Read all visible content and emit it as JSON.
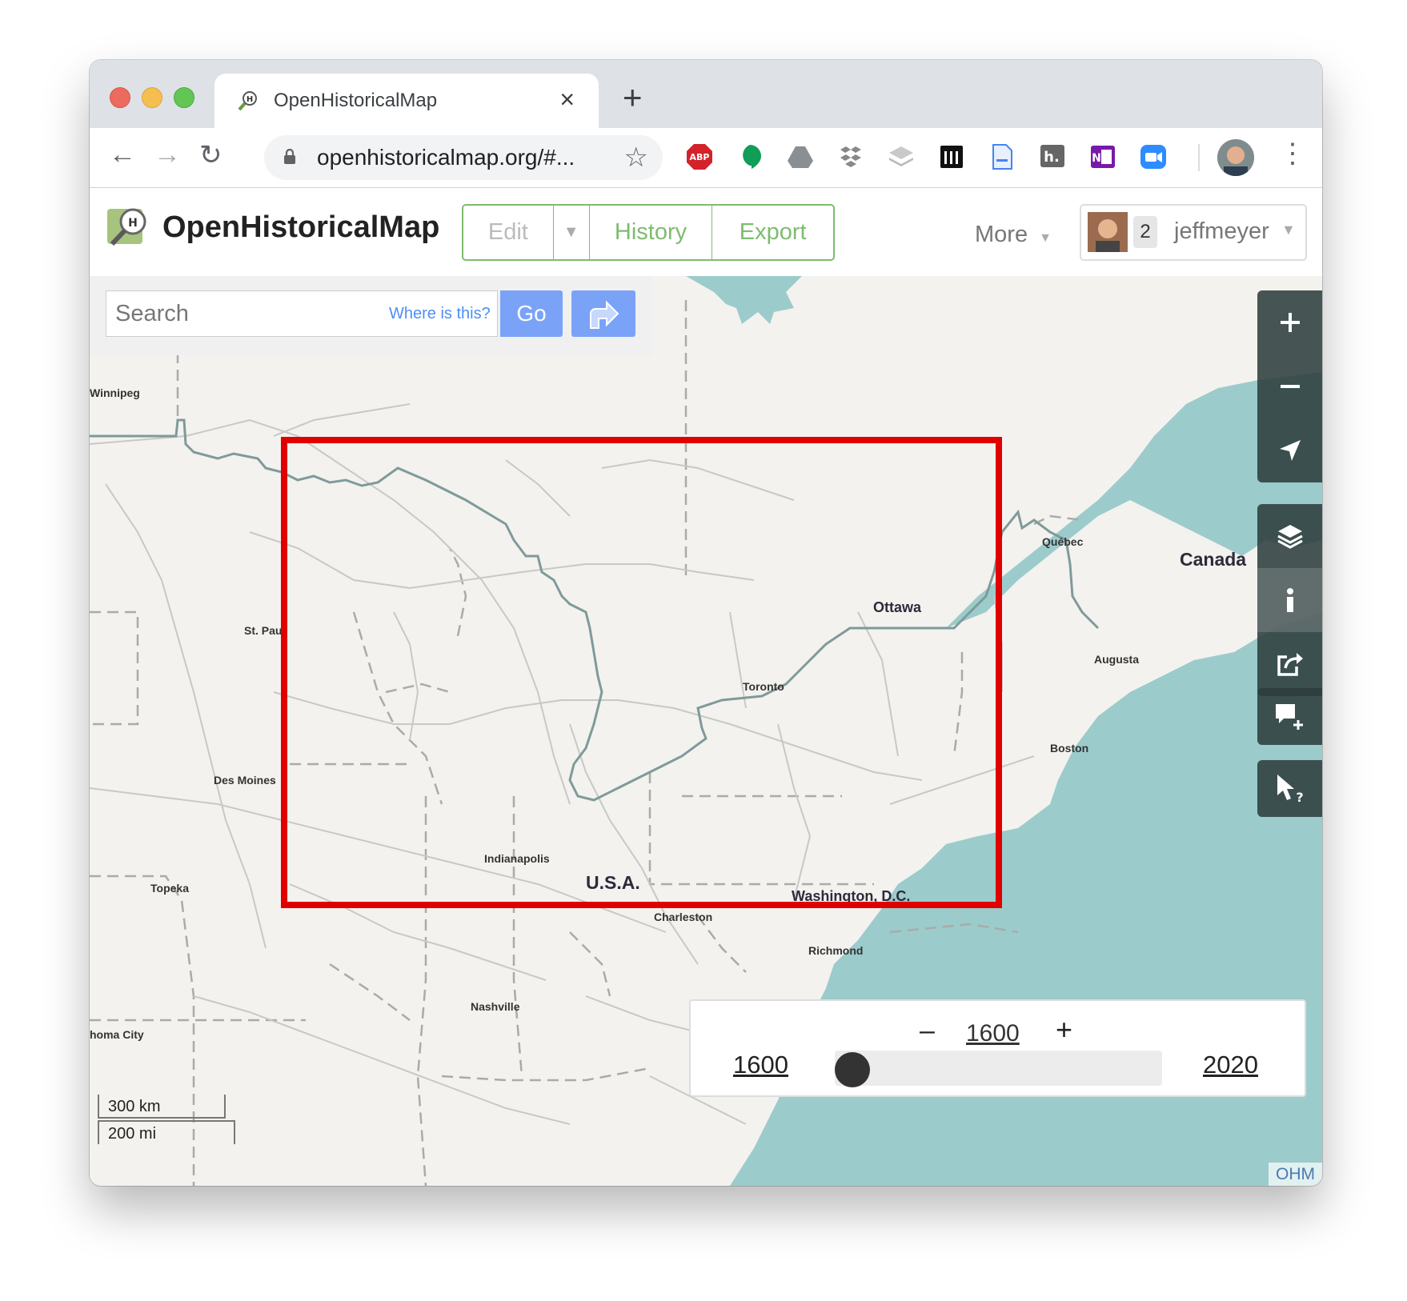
{
  "browser": {
    "tab_title": "OpenHistoricalMap",
    "url": "openhistoricalmap.org/#...",
    "extensions": [
      "adblock-plus-icon",
      "hangouts-icon",
      "google-drive-icon",
      "dropbox-like-icon",
      "layers-icon",
      "archive-icon",
      "docs-icon",
      "hypothesis-icon",
      "onenote-icon",
      "zoom-icon"
    ],
    "abp_label": "ABP",
    "hypothesis_label": "h."
  },
  "header": {
    "logo_text": "OpenHistoricalMap",
    "edit_label": "Edit",
    "history_label": "History",
    "export_label": "Export",
    "more_label": "More",
    "user_count": "2",
    "username": "jeffmeyer"
  },
  "search": {
    "placeholder": "Search",
    "where_is_this": "Where is this?",
    "go_label": "Go"
  },
  "map": {
    "places": {
      "winnipeg": "Winnipeg",
      "st_paul": "St. Pau",
      "des_moines": "Des Moines",
      "topeka": "Topeka",
      "oklahoma_city": "homa City",
      "indianapolis": "Indianapolis",
      "usa": "U.S.A.",
      "washington": "Washington, D.C.",
      "charleston": "Charleston",
      "richmond": "Richmond",
      "nashville": "Nashville",
      "toronto": "Toronto",
      "ottawa": "Ottawa",
      "quebec": "Québec",
      "canada": "Canada",
      "augusta": "Augusta",
      "boston": "Boston"
    },
    "water_color": "#9ccbcb",
    "land_color": "#f3f2ee",
    "highlight_color": "#e00000"
  },
  "timeslider": {
    "current": "1600",
    "min": "1600",
    "max": "2020",
    "position": 0
  },
  "scale": {
    "km": "300 km",
    "mi": "200 mi"
  },
  "attribution": "OHM"
}
